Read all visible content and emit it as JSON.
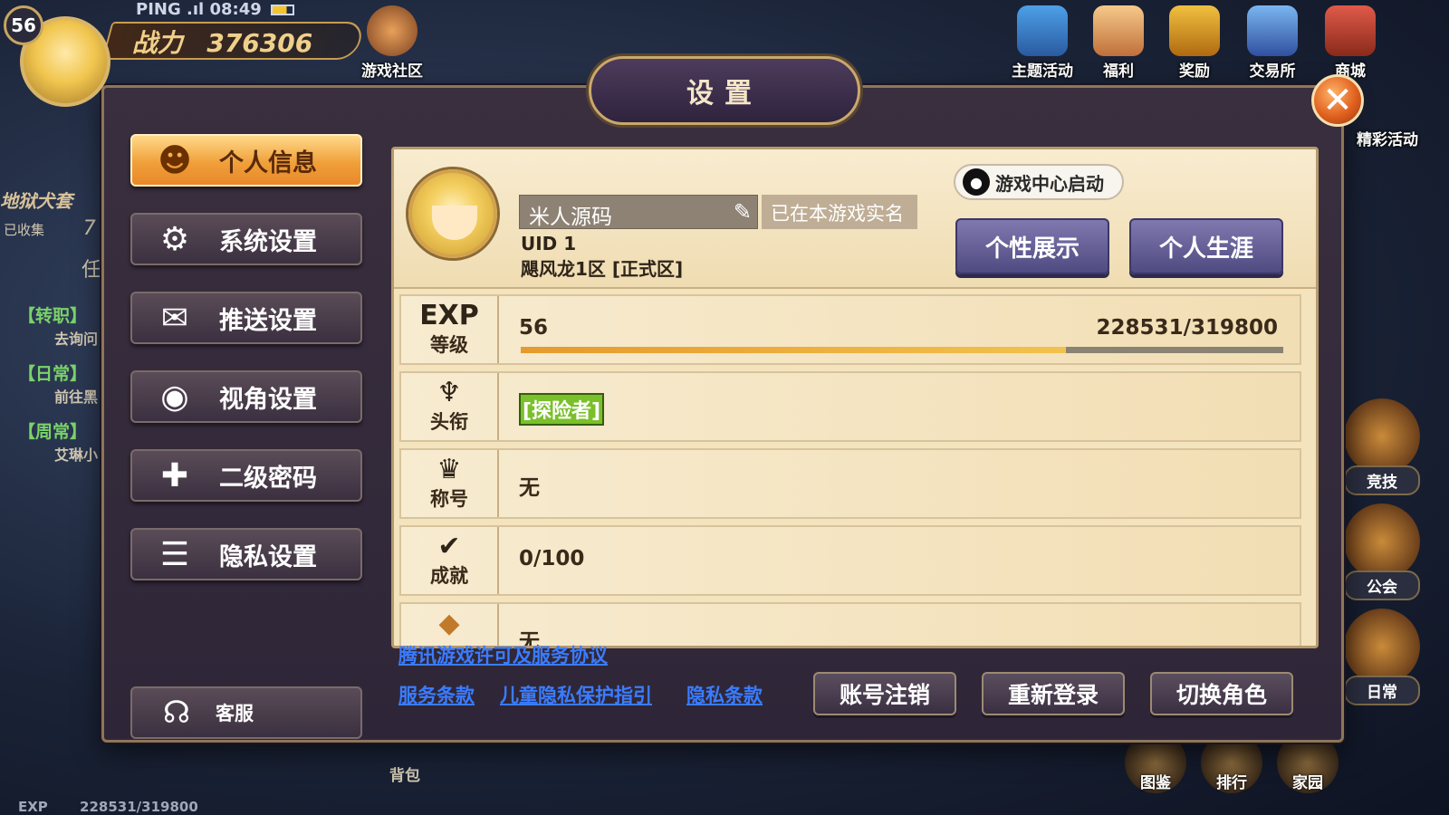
{
  "hud": {
    "level": "56",
    "ping": "PING",
    "time": "08:49",
    "power_label": "战力",
    "power_value": "376306",
    "community": "游戏社区",
    "top_icons": [
      "主题活动",
      "福利",
      "奖励",
      "交易所",
      "商城"
    ],
    "side_event": "精彩活动",
    "left_title": "地狱犬套",
    "collected": "已收集",
    "collected_num": "7",
    "task_tab": "任",
    "quests": [
      {
        "tag": "【转职】",
        "sub": "去询问"
      },
      {
        "tag": "【日常】",
        "sub": "前往黑"
      },
      {
        "tag": "【周常】",
        "sub": "艾琳小"
      }
    ],
    "right_icons": [
      "竞技",
      "公会",
      "日常"
    ],
    "bottom_icons": [
      "图鉴",
      "排行",
      "家园"
    ],
    "bag": "背包",
    "exp_label": "EXP",
    "exp_value": "228531/319800"
  },
  "dialog": {
    "title": "设置",
    "close": "✕"
  },
  "menu": {
    "items": [
      {
        "label": "个人信息",
        "icon": "person-icon",
        "glyph": "☻"
      },
      {
        "label": "系统设置",
        "icon": "gear-icon",
        "glyph": "⚙"
      },
      {
        "label": "推送设置",
        "icon": "message-icon",
        "glyph": "✉"
      },
      {
        "label": "视角设置",
        "icon": "eye-icon",
        "glyph": "◉"
      },
      {
        "label": "二级密码",
        "icon": "shield-icon",
        "glyph": "✚"
      },
      {
        "label": "隐私设置",
        "icon": "list-icon",
        "glyph": "☰"
      }
    ],
    "service": "客服",
    "service_glyph": "☊"
  },
  "profile": {
    "name": "米人源码",
    "verified": "已在本游戏实名",
    "uid": "UID 1",
    "server": "飓风龙1区 [正式区]",
    "qq_launch": "游戏中心启动",
    "btn_show": "个性展示",
    "btn_career": "个人生涯"
  },
  "rows": {
    "exp": {
      "icon": "EXP",
      "label": "等级",
      "level": "56",
      "value": "228531/319800",
      "progress": 0.7146
    },
    "title": {
      "icon": "♆",
      "label": "头衔",
      "value": "[探险者]"
    },
    "nickname": {
      "icon": "♛",
      "label": "称号",
      "value": "无"
    },
    "achievement": {
      "icon": "✔",
      "label": "成就",
      "value": "0/100"
    },
    "badge": {
      "icon": "◆",
      "label": "",
      "value": "无"
    }
  },
  "footer": {
    "license": "腾讯游戏许可及服务协议",
    "terms": "服务条款",
    "child_privacy": "儿童隐私保护指引",
    "privacy": "隐私条款",
    "btn_cancel_account": "账号注销",
    "btn_relogin": "重新登录",
    "btn_switch_role": "切换角色"
  }
}
